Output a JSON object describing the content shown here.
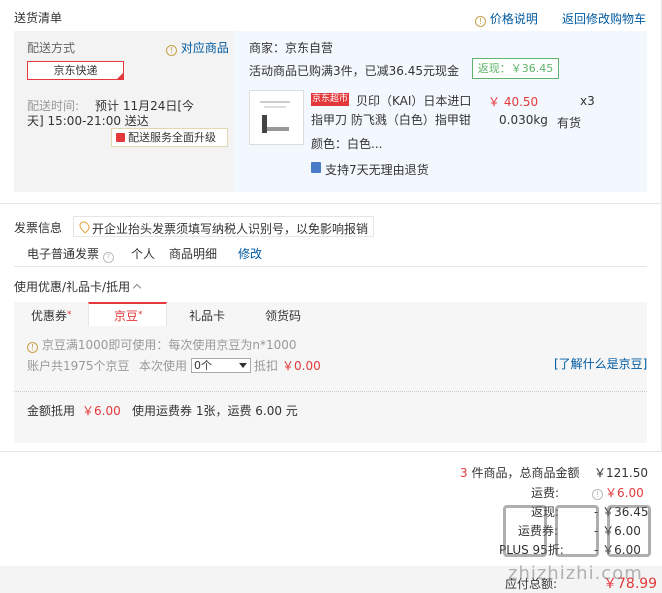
{
  "section_title": "送货清单",
  "header_links": {
    "price_help": "价格说明",
    "back_cart": "返回修改购物车"
  },
  "delivery": {
    "method_label": "配送方式",
    "match_goods": "对应商品",
    "express": "京东快递",
    "time_label": "配送时间:",
    "time_line1": "预计 11月24日[今",
    "time_line2": "天] 15:00-21:00 送达",
    "upgrade": "配送服务全面升级"
  },
  "merchant": {
    "name": "商家：京东自营",
    "promo": "活动商品已购满3件，已减36.45元现金",
    "rebate": "返现：￥36.45"
  },
  "product": {
    "badge": "京东超市",
    "title_line1": "贝印（KAI）日本进口",
    "title_line2": "指甲刀 防飞溅（白色）指甲钳",
    "price": "￥ 40.50",
    "qty": "x3",
    "weight": "0.030kg",
    "stock": "有货",
    "color": "颜色：白色...",
    "return_policy": "支持7天无理由退货"
  },
  "invoice": {
    "label": "发票信息",
    "tip": "开企业抬头发票须填写纳税人识别号，以免影响报销",
    "type": "电子普通发票",
    "title": "个人",
    "content": "商品明细",
    "edit": "修改"
  },
  "coupon": {
    "heading": "使用优惠/礼品卡/抵用",
    "tabs": [
      "优惠券",
      "京豆",
      "礼品卡",
      "领货码"
    ],
    "beans_rule": "京豆满1000即可使用：每次使用京豆为n*1000",
    "account_beans": "账户共1975个京豆",
    "use_now": "本次使用",
    "select_value": "0个",
    "deduct_label": "抵扣",
    "deduct_value": "￥0.00",
    "what_is": "[了解什么是京豆]",
    "amount_label": "金额抵用",
    "amount_value": "￥6.00",
    "freight_note": "使用运费券 1张，运费 6.00 元"
  },
  "summary": {
    "count": "3",
    "count_suffix": "件商品，总商品金额",
    "goods_total": "￥121.50",
    "freight_label": "运费:",
    "freight_value": "￥6.00",
    "rebate_label": "返现:",
    "rebate_value": "- ￥36.45",
    "row4_label": "运费券:",
    "row4_value": "- ￥6.00",
    "row5_label": "PLUS 95折:",
    "row5_value": "- ￥6.00",
    "payable_label": "应付总额:",
    "payable_value": "￥78.99"
  },
  "watermark": "zhizhizhi.com",
  "colors": {
    "accent_red": "#e4393c",
    "link_blue": "#005aa0",
    "rebate_green": "#5fb36b"
  }
}
